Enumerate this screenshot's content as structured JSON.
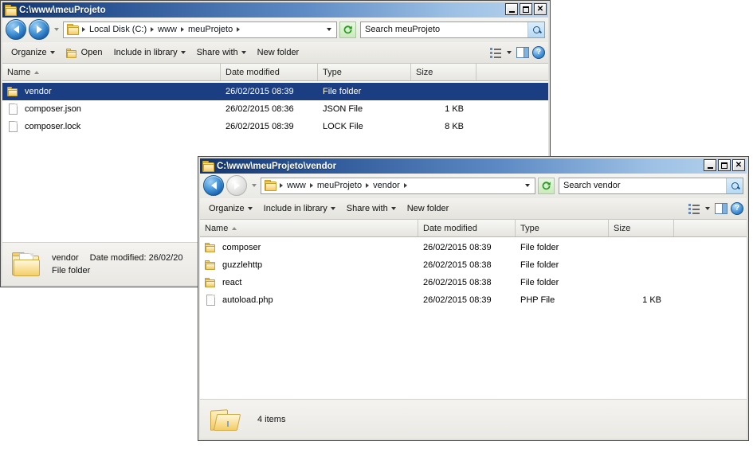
{
  "windows": [
    {
      "id": "window-meuprojeto",
      "title": "C:\\www\\meuProjeto",
      "titlebar_buttons": {
        "minimize": "_",
        "maximize": "□",
        "close": "X"
      },
      "nav": {
        "back": "back-arrow",
        "forward": "forward-arrow",
        "history": "history-dropdown"
      },
      "breadcrumb": [
        "Local Disk (C:)",
        "www",
        "meuProjeto"
      ],
      "refresh_label": "refresh-icon",
      "search": {
        "placeholder": "Search meuProjeto",
        "value": "",
        "button": "search-icon"
      },
      "toolbar": {
        "organize": "Organize",
        "open": "Open",
        "include_in_library": "Include in library",
        "share_with": "Share with",
        "new_folder": "New folder",
        "view_label": "change-view",
        "preview_pane": "preview-pane",
        "help": "?"
      },
      "columns": [
        "Name",
        "Date modified",
        "Type",
        "Size"
      ],
      "sort_column": "Name",
      "rows": [
        {
          "name": "vendor",
          "date": "26/02/2015 08:39",
          "type": "File folder",
          "size": "",
          "icon": "folder-icon",
          "selected": true
        },
        {
          "name": "composer.json",
          "date": "26/02/2015 08:36",
          "type": "JSON File",
          "size": "1 KB",
          "icon": "file-icon",
          "selected": false
        },
        {
          "name": "composer.lock",
          "date": "26/02/2015 08:39",
          "type": "LOCK File",
          "size": "8 KB",
          "icon": "file-icon",
          "selected": false
        }
      ],
      "details": {
        "item_name": "vendor",
        "date_label": "Date modified:",
        "date_value": "26/02/20",
        "type_text": "File folder"
      }
    },
    {
      "id": "window-vendor",
      "title": "C:\\www\\meuProjeto\\vendor",
      "titlebar_buttons": {
        "minimize": "_",
        "maximize": "□",
        "close": "X"
      },
      "nav": {
        "back": "back-arrow",
        "forward": "forward-arrow",
        "history": "history-dropdown"
      },
      "breadcrumb": [
        "www",
        "meuProjeto",
        "vendor"
      ],
      "refresh_label": "refresh-icon",
      "search": {
        "placeholder": "Search vendor",
        "value": "",
        "button": "search-icon"
      },
      "toolbar": {
        "organize": "Organize",
        "include_in_library": "Include in library",
        "share_with": "Share with",
        "new_folder": "New folder",
        "view_label": "change-view",
        "preview_pane": "preview-pane",
        "help": "?"
      },
      "columns": [
        "Name",
        "Date modified",
        "Type",
        "Size"
      ],
      "sort_column": "Name",
      "rows": [
        {
          "name": "composer",
          "date": "26/02/2015 08:39",
          "type": "File folder",
          "size": "",
          "icon": "folder-icon",
          "selected": false
        },
        {
          "name": "guzzlehttp",
          "date": "26/02/2015 08:38",
          "type": "File folder",
          "size": "",
          "icon": "folder-icon",
          "selected": false
        },
        {
          "name": "react",
          "date": "26/02/2015 08:38",
          "type": "File folder",
          "size": "",
          "icon": "folder-icon",
          "selected": false
        },
        {
          "name": "autoload.php",
          "date": "26/02/2015 08:39",
          "type": "PHP File",
          "size": "1 KB",
          "icon": "file-icon",
          "selected": false
        }
      ],
      "status": {
        "item_count": "4 items"
      }
    }
  ],
  "colors": {
    "title_gradient_start": "#13366e",
    "title_gradient_end": "#b9d3ee",
    "selection": "#1b3d82",
    "toolbar_bg": "#e9e8e3",
    "window_bg": "#f0f0ef",
    "folder_yellow": "#f2cd69"
  }
}
